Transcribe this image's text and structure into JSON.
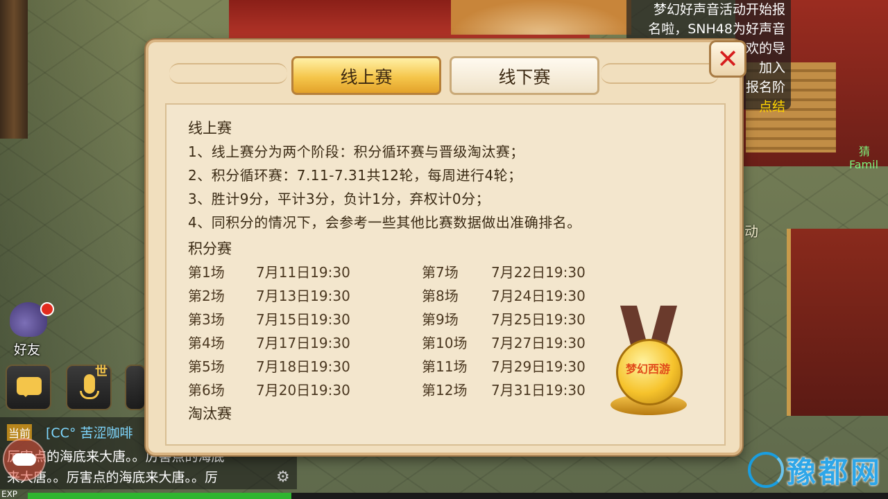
{
  "notice": {
    "lines": [
      "梦幻好声音活动开始报",
      "名啦，SNH48为好声音",
      "导师，选择你喜欢的导",
      "加入",
      "报名阶",
      "点结"
    ]
  },
  "background_text": {
    "family_top": "猜",
    "family": "Famil",
    "activity": "动"
  },
  "dialog": {
    "tabs": [
      {
        "label": "线上赛",
        "active": true
      },
      {
        "label": "线下赛",
        "active": false
      }
    ],
    "close_symbol": "✕",
    "heading_online": "线上赛",
    "rules": [
      "1、线上赛分为两个阶段：积分循环赛与晋级淘汰赛；",
      "2、积分循环赛：7.11-7.31共12轮，每周进行4轮；",
      "3、胜计9分，平计3分，负计1分，弃权计0分；",
      "4、同积分的情况下，会参考一些其他比赛数据做出准确排名。"
    ],
    "heading_points": "积分赛",
    "schedule_left": [
      {
        "round": "第1场",
        "time": "7月11日19:30"
      },
      {
        "round": "第2场",
        "time": "7月13日19:30"
      },
      {
        "round": "第3场",
        "time": "7月15日19:30"
      },
      {
        "round": "第4场",
        "time": "7月17日19:30"
      },
      {
        "round": "第5场",
        "time": "7月18日19:30"
      },
      {
        "round": "第6场",
        "time": "7月20日19:30"
      }
    ],
    "schedule_right": [
      {
        "round": "第7场",
        "time": "7月22日19:30"
      },
      {
        "round": "第8场",
        "time": "7月24日19:30"
      },
      {
        "round": "第9场",
        "time": "7月25日19:30"
      },
      {
        "round": "第10场",
        "time": "7月27日19:30"
      },
      {
        "round": "第11场",
        "time": "7月29日19:30"
      },
      {
        "round": "第12场",
        "time": "7月31日19:30"
      }
    ],
    "heading_knockout": "淘汰赛",
    "medal_logo": "梦幻西游"
  },
  "hud": {
    "friend_label": "好友",
    "mic_tag": "世",
    "chat_tag": "当前",
    "chat_line1": "[CC° 苦涩咖啡",
    "chat_line2": "厉害点的海底来大唐。。厉害点的海底",
    "chat_line3": "来大唐。。厉害点的海底来大唐。。厉",
    "gear_symbol": "⚙",
    "exp_label": "EXP"
  },
  "watermark": {
    "text": "豫都网"
  },
  "colors": {
    "tab_active": "#f5c64b",
    "close": "#d61d1d",
    "panel": "#f1dfbe",
    "watermark": "#2ea6e8"
  }
}
